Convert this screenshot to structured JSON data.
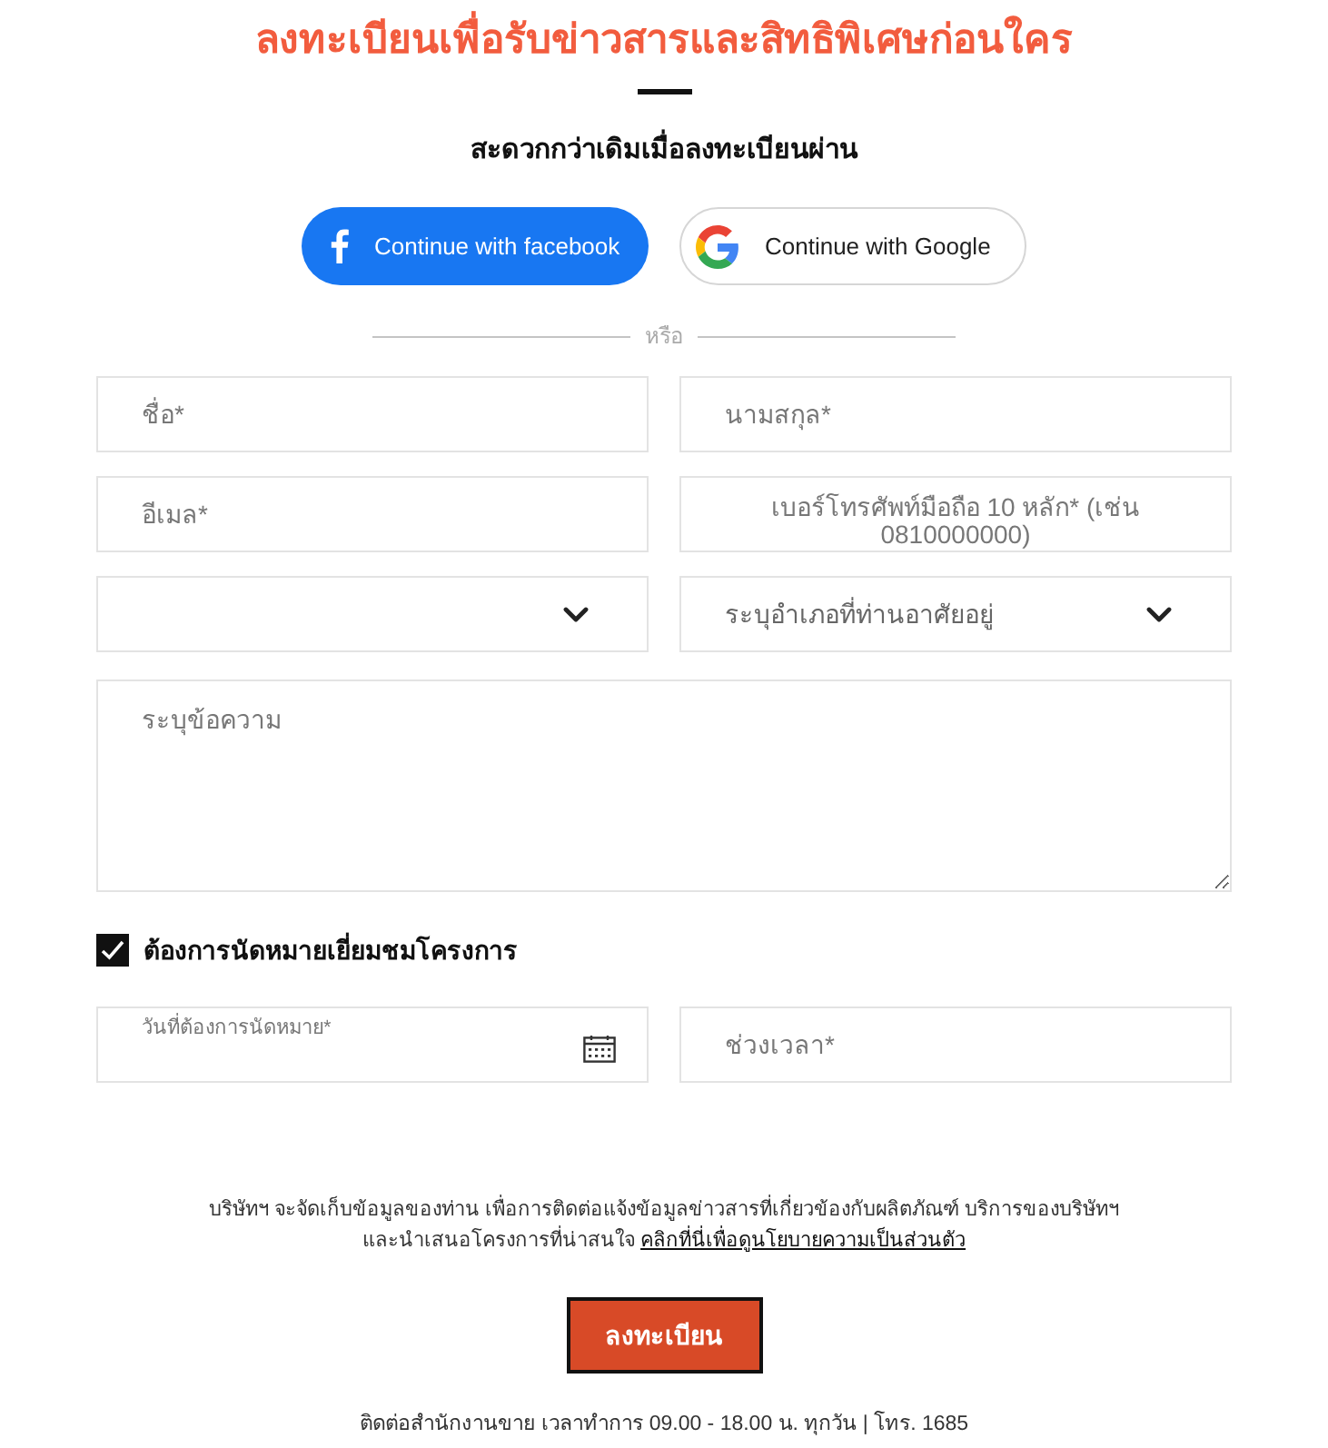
{
  "title": "ลงทะเบียนเพื่อรับข่าวสารและสิทธิพิเศษก่อนใคร",
  "subtitle": "สะดวกกว่าเดิมเมื่อลงทะเบียนผ่าน",
  "social_buttons": [
    {
      "kind": "facebook",
      "label": "Continue with facebook"
    },
    {
      "kind": "google",
      "label": "Continue with Google"
    }
  ],
  "divider_label": "หรือ",
  "fields": [
    {
      "kind": "text",
      "placeholder": "ชื่อ*"
    },
    {
      "kind": "text",
      "placeholder": "นามสกุล*"
    },
    {
      "kind": "text",
      "placeholder": "อีเมล*"
    },
    {
      "kind": "phone",
      "placeholder": "เบอร์โทรศัพท์มือถือ 10 หลัก* (เช่น 0810000000)"
    },
    {
      "kind": "select"
    },
    {
      "kind": "select",
      "placeholder": "ระบุอำเภอที่ท่านอาศัยอยู่"
    }
  ],
  "message": {
    "placeholder": "ระบุข้อความ"
  },
  "appointment": {
    "label": "ต้องการนัดหมายเยี่ยมชมโครงการ",
    "checked": true
  },
  "appointment_fields": [
    {
      "kind": "date",
      "placeholder": "วันที่ต้องการนัดหมาย*"
    },
    {
      "kind": "text",
      "placeholder": "ช่วงเวลา*"
    }
  ],
  "consent": {
    "text": "บริษัทฯ จะจัดเก็บข้อมูลของท่าน เพื่อการติดต่อแจ้งข้อมูลข่าวสารที่เกี่ยวข้องกับผลิตภัณฑ์ บริการของบริษัทฯ และนำเสนอโครงการที่น่าสนใจ",
    "link": "คลิกที่นี่เพื่อดูนโยบายความเป็นส่วนตัว"
  },
  "submit_button": "ลงทะเบียน",
  "footer": "ติดต่อสำนักงานขาย เวลาทำการ 09.00 - 18.00 น. ทุกวัน | โทร. 1685"
}
